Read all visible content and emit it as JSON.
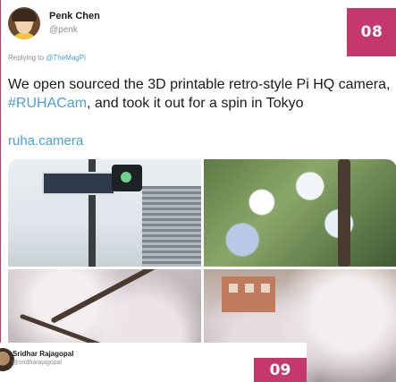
{
  "tweet": {
    "author_name": "Penk Chen",
    "author_handle": "@penk",
    "reply_prefix": "Replying to",
    "reply_mention": "@TheMagPi",
    "text_part1": "We open sourced the 3D printable retro-style Pi HQ camera, ",
    "hashtag": "#RUHACam",
    "text_part2": ", and took it out for a spin in Tokyo",
    "link": "ruha.camera"
  },
  "badges": {
    "top": "08",
    "bottom": "09"
  },
  "next_tweet": {
    "author_name": "Sridhar Rajagopal",
    "author_handle": "@sridharajagopal"
  },
  "colors": {
    "accent": "#c5386b",
    "link": "#4a9fd8",
    "text": "#1a1a1a",
    "muted": "#8a8f94"
  }
}
